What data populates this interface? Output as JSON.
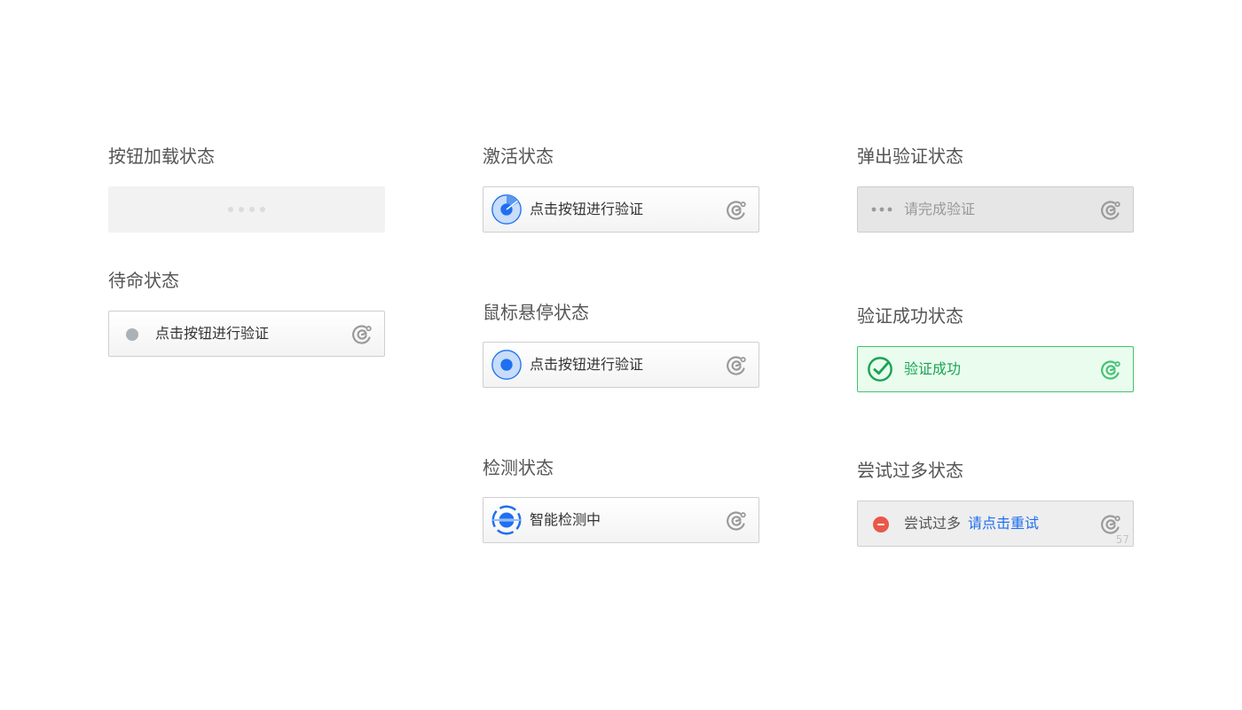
{
  "sections": {
    "loading": {
      "title": "按钮加载状态"
    },
    "idle": {
      "title": "待命状态",
      "label": "点击按钮进行验证"
    },
    "active": {
      "title": "激活状态",
      "label": "点击按钮进行验证"
    },
    "hover": {
      "title": "鼠标悬停状态",
      "label": "点击按钮进行验证"
    },
    "detecting": {
      "title": "检测状态",
      "label": "智能检测中"
    },
    "popup": {
      "title": "弹出验证状态",
      "label": "请完成验证"
    },
    "success": {
      "title": "验证成功状态",
      "label": "验证成功"
    },
    "too_many": {
      "title": "尝试过多状态",
      "label": "尝试过多",
      "retry": "请点击重试",
      "corner_number": "57"
    }
  },
  "colors": {
    "accent_blue": "#1f6ff0",
    "success_green": "#18a452",
    "error_red": "#e8584a",
    "logo_gray": "#9a9a9a",
    "logo_green": "#45c275"
  },
  "icons": {
    "idle": "gray-dot-icon",
    "active": "blue-radar-icon",
    "hover": "blue-target-icon",
    "detecting": "scanning-icon",
    "popup": "dots-icon",
    "success": "check-circle-icon",
    "too_many": "minus-circle-icon",
    "logo": "captcha-logo-icon"
  }
}
